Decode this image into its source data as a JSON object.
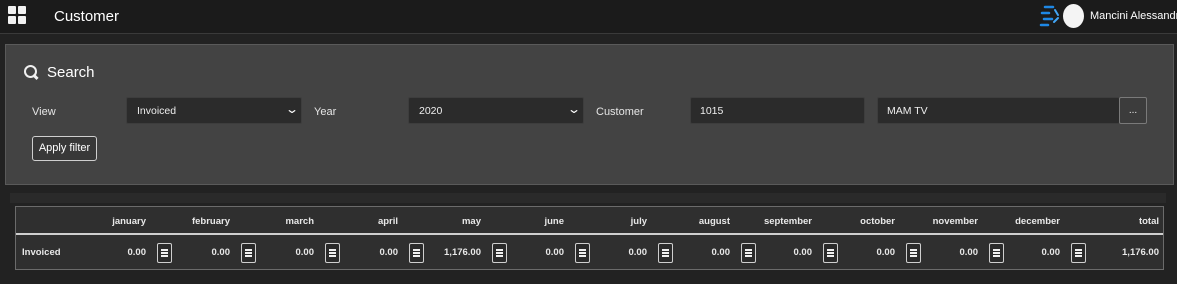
{
  "topbar": {
    "apps_icon": "apps-grid-icon",
    "title": "Customer",
    "user_name": "Mancini Alessandro",
    "user_menu_icon": "chevron-down-icon"
  },
  "search": {
    "icon": "search-icon",
    "title": "Search",
    "view_label": "View",
    "view_value": "Invoiced",
    "year_label": "Year",
    "year_value": "2020",
    "customer_label": "Customer",
    "customer_code": "1015",
    "customer_name": "MAM TV",
    "lookup_label": "...",
    "apply_label": "Apply filter"
  },
  "table": {
    "headers": [
      "january",
      "february",
      "march",
      "april",
      "may",
      "june",
      "july",
      "august",
      "september",
      "october",
      "november",
      "december",
      "total"
    ],
    "rows": [
      {
        "label": "Invoiced",
        "values": [
          "0.00",
          "0.00",
          "0.00",
          "0.00",
          "1,176.00",
          "0.00",
          "0.00",
          "0.00",
          "0.00",
          "0.00",
          "0.00",
          "0.00"
        ],
        "total": "1,176.00"
      }
    ],
    "detail_icon": "list-detail-icon"
  },
  "colors": {
    "topbar": "#1b1b1b",
    "panel": "#434343",
    "input": "#2b2b2b",
    "brand": "#1e88e5"
  }
}
